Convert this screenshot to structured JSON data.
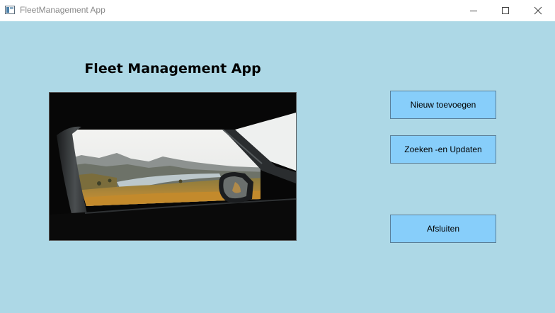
{
  "window": {
    "title": "FleetManagement App",
    "icons": {
      "app": "app-window-icon",
      "minimize": "minimize-icon",
      "maximize": "maximize-icon",
      "close": "close-icon"
    }
  },
  "main": {
    "heading": "Fleet Management App",
    "image": "car-window-landscape-photo",
    "buttons": {
      "new": "Nieuw toevoegen",
      "search_update": "Zoeken -en Updaten",
      "exit": "Afsluiten"
    }
  },
  "colors": {
    "background": "#add8e6",
    "button": "#87cefa",
    "titlebar": "#ffffff"
  }
}
